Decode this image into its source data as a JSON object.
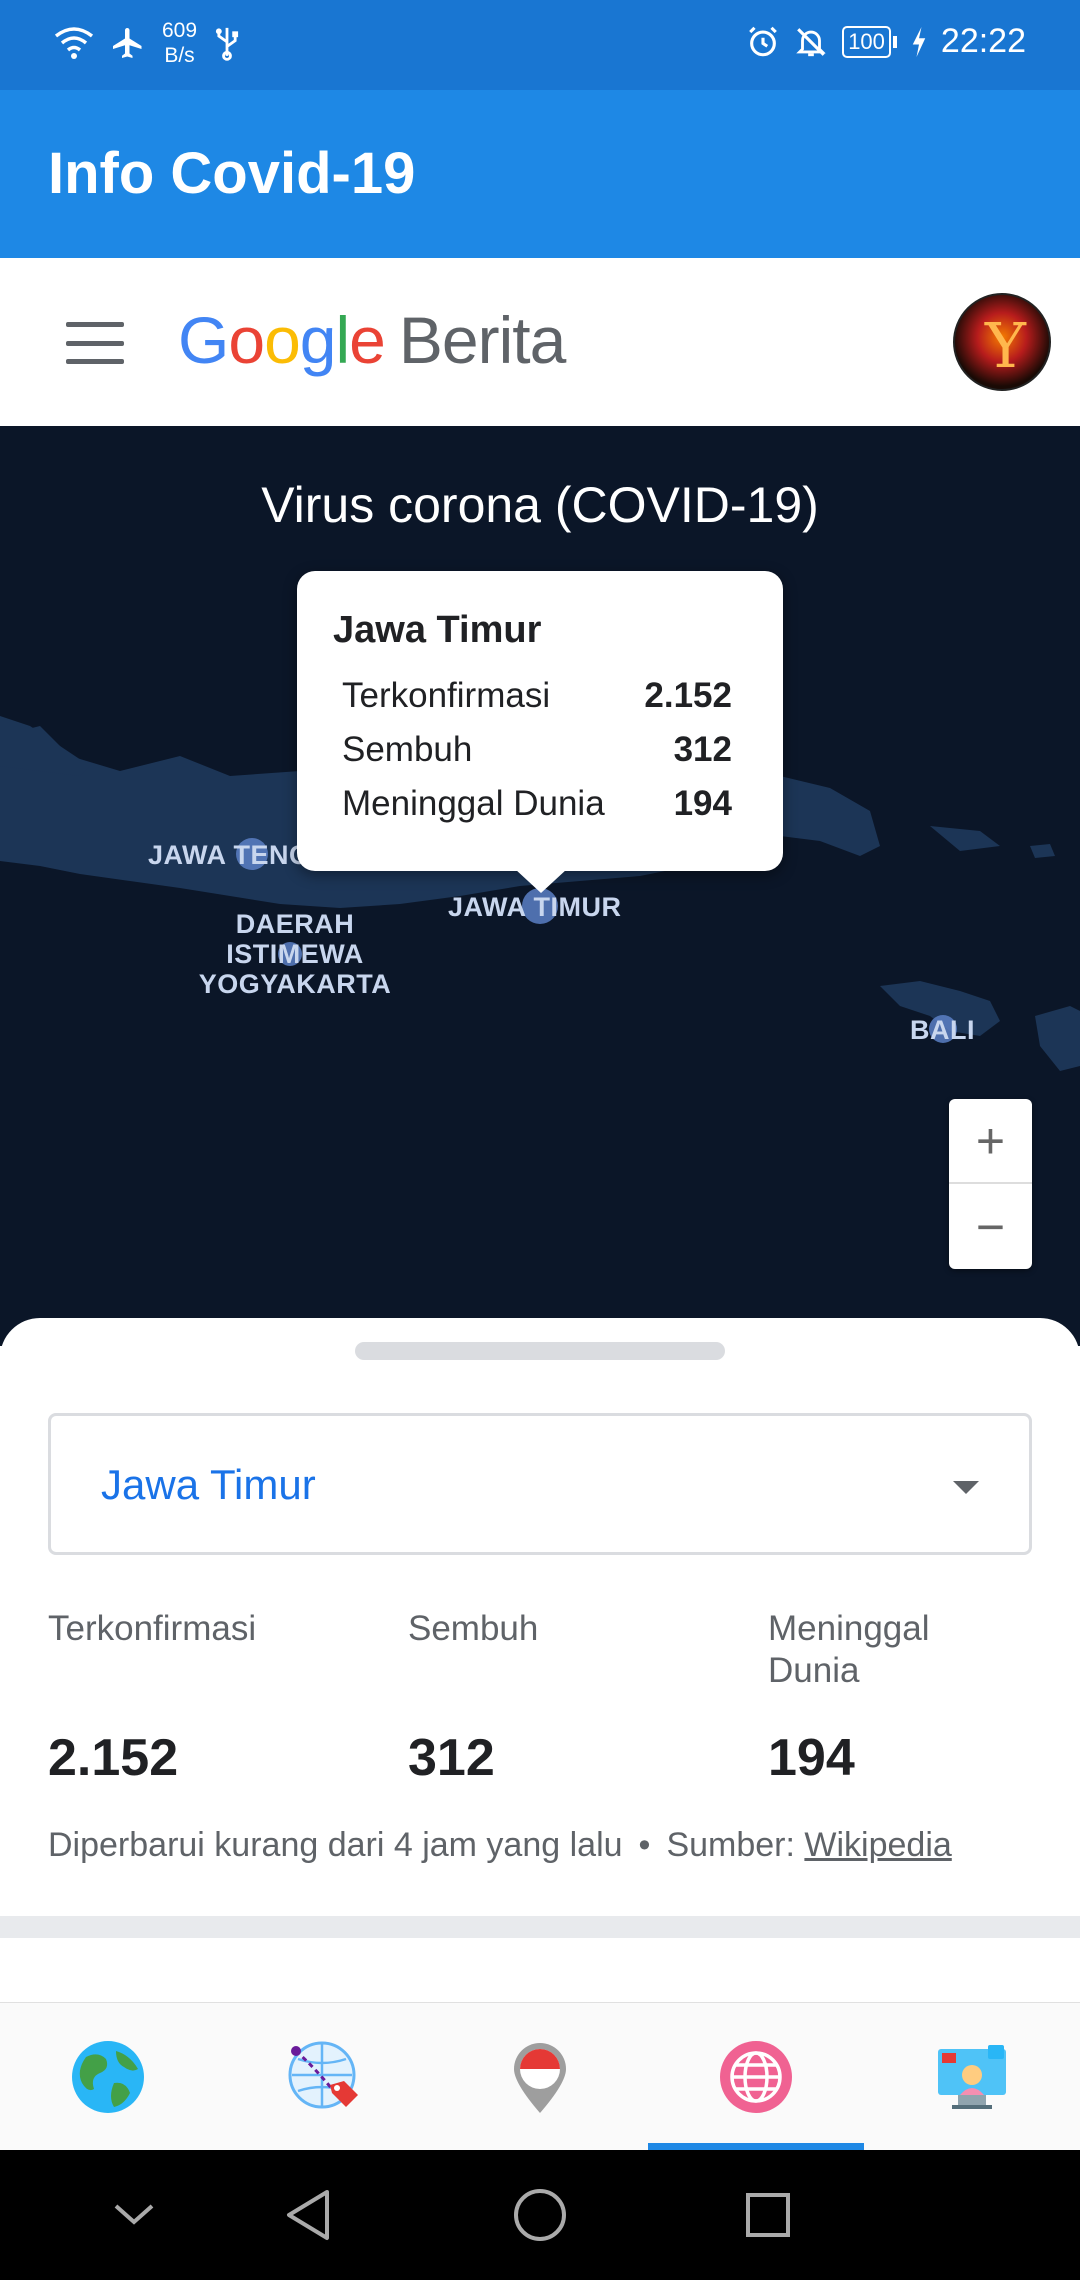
{
  "status_bar": {
    "net_speed_value": "609",
    "net_speed_unit": "B/s",
    "battery": "100",
    "time": "22:22",
    "icons": [
      "wifi-icon",
      "airplane-icon",
      "usb-icon",
      "alarm-icon",
      "mute-icon",
      "battery-icon",
      "charging-icon"
    ]
  },
  "app_bar": {
    "title": "Info Covid-19"
  },
  "header": {
    "logo_letters": [
      "G",
      "o",
      "o",
      "g",
      "l",
      "e"
    ],
    "logo_suffix": "Berita",
    "menu_icon": "menu-icon"
  },
  "map": {
    "title": "Virus corona (COVID-19)",
    "labels": {
      "jawa_tengah": "JAWA TENGAH",
      "diy_1": "DAERAH",
      "diy_2": "ISTIMEWA",
      "diy_3": "YOGYAKARTA",
      "jawa_timur": "JAWA TIMUR",
      "bali": "BALI"
    },
    "tooltip": {
      "title": "Jawa Timur",
      "rows": [
        {
          "label": "Terkonfirmasi",
          "value": "2.152"
        },
        {
          "label": "Sembuh",
          "value": "312"
        },
        {
          "label": "Meninggal Dunia",
          "value": "194"
        }
      ]
    },
    "zoom_in": "+",
    "zoom_out": "−",
    "colors": {
      "sea": "#0b1628",
      "land": "#1c3556",
      "marker": "#5b7fc4"
    }
  },
  "sheet": {
    "selected_region": "Jawa Timur",
    "stats": [
      {
        "label": "Terkonfirmasi",
        "value": "2.152"
      },
      {
        "label": "Sembuh",
        "value": "312"
      },
      {
        "label": "Meninggal Dunia",
        "value": "194"
      }
    ],
    "footnote_updated": "Diperbarui kurang dari 4 jam yang lalu",
    "footnote_dot": "•",
    "footnote_source_prefix": "Sumber:",
    "footnote_source_link": "Wikipedia"
  },
  "tabs": [
    {
      "icon": "globe-icon",
      "active": false
    },
    {
      "icon": "route-tag-icon",
      "active": false
    },
    {
      "icon": "indonesia-pin-icon",
      "active": false
    },
    {
      "icon": "world-grid-icon",
      "active": true
    },
    {
      "icon": "news-presenter-icon",
      "active": false
    }
  ],
  "nav_bar": {
    "icons": [
      "collapse-icon",
      "back-icon",
      "home-icon",
      "recents-icon"
    ]
  },
  "accent_colors": {
    "status_bar": "#1976d2",
    "app_bar": "#1e88e5",
    "link_blue": "#1a73e8"
  }
}
